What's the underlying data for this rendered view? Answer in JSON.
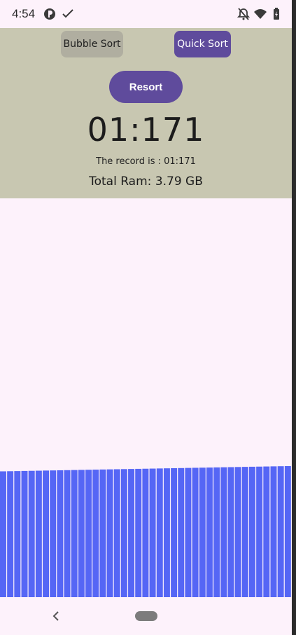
{
  "status_bar": {
    "time": "4:54",
    "icons": [
      "app-notification-icon",
      "check-icon",
      "notifications-off-icon",
      "wifi-icon",
      "battery-icon"
    ]
  },
  "controls": {
    "bubble_sort_label": "Bubble Sort",
    "quick_sort_label": "Quick Sort",
    "resort_label": "Resort"
  },
  "stats": {
    "timer": "01:171",
    "record": "The record is : 01:171",
    "total_ram": "Total Ram: 3.79 GB"
  },
  "visualization": {
    "bar_color": "#5566f5",
    "bar_heights_relative": [
      0.96,
      0.961,
      0.962,
      0.963,
      0.964,
      0.965,
      0.966,
      0.967,
      0.968,
      0.969,
      0.97,
      0.971,
      0.972,
      0.973,
      0.974,
      0.975,
      0.976,
      0.977,
      0.978,
      0.979,
      0.98,
      0.981,
      0.982,
      0.983,
      0.984,
      0.985,
      0.986,
      0.987,
      0.988,
      0.989,
      0.99,
      0.991,
      0.992,
      0.993,
      0.994,
      0.995,
      0.996,
      0.997,
      0.998,
      0.999,
      1.0
    ]
  },
  "colors": {
    "panel": "#c8c7b1",
    "accent": "#5f4b9c",
    "background": "#fdf2fb"
  },
  "nav": {
    "icons": [
      "back-icon",
      "home-pill"
    ]
  }
}
